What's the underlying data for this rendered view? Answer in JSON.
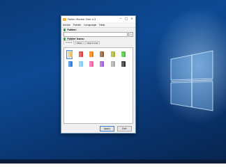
{
  "window": {
    "title": "Folder Marker Free 4.3",
    "controls": [
      "−",
      "□",
      "×"
    ]
  },
  "menu": [
    "Action",
    "Folder",
    "Language",
    "Help"
  ],
  "folder_section": {
    "label": "Folder:",
    "value": "",
    "browse_label": "…"
  },
  "icons_section": {
    "label": "Folder Icons:",
    "tabs": [
      "Colors",
      "Main",
      "User Icons"
    ],
    "active_tab": "Colors",
    "icons": [
      {
        "name": "folder-default-icon",
        "color": "#e8c068",
        "selected": true
      },
      {
        "name": "folder-red-icon",
        "color": "#e53935"
      },
      {
        "name": "folder-orange-icon",
        "color": "#f57c00"
      },
      {
        "name": "folder-brown-icon",
        "color": "#8d5a2b"
      },
      {
        "name": "folder-olive-icon",
        "color": "#a8b428"
      },
      {
        "name": "folder-green-icon",
        "color": "#43c13c"
      },
      {
        "name": "folder-blue-icon",
        "color": "#2e86e0"
      },
      {
        "name": "folder-light-blue-icon",
        "color": "#7ecbf0"
      },
      {
        "name": "folder-pink-icon",
        "color": "#ec5aa6"
      },
      {
        "name": "folder-violet-icon",
        "color": "#9b59d6"
      },
      {
        "name": "folder-grey-icon",
        "color": "#a8a8a8"
      },
      {
        "name": "folder-black-icon",
        "color": "#2a2a2a"
      }
    ]
  },
  "buttons": {
    "apply": "Apply",
    "exit": "Exit"
  }
}
